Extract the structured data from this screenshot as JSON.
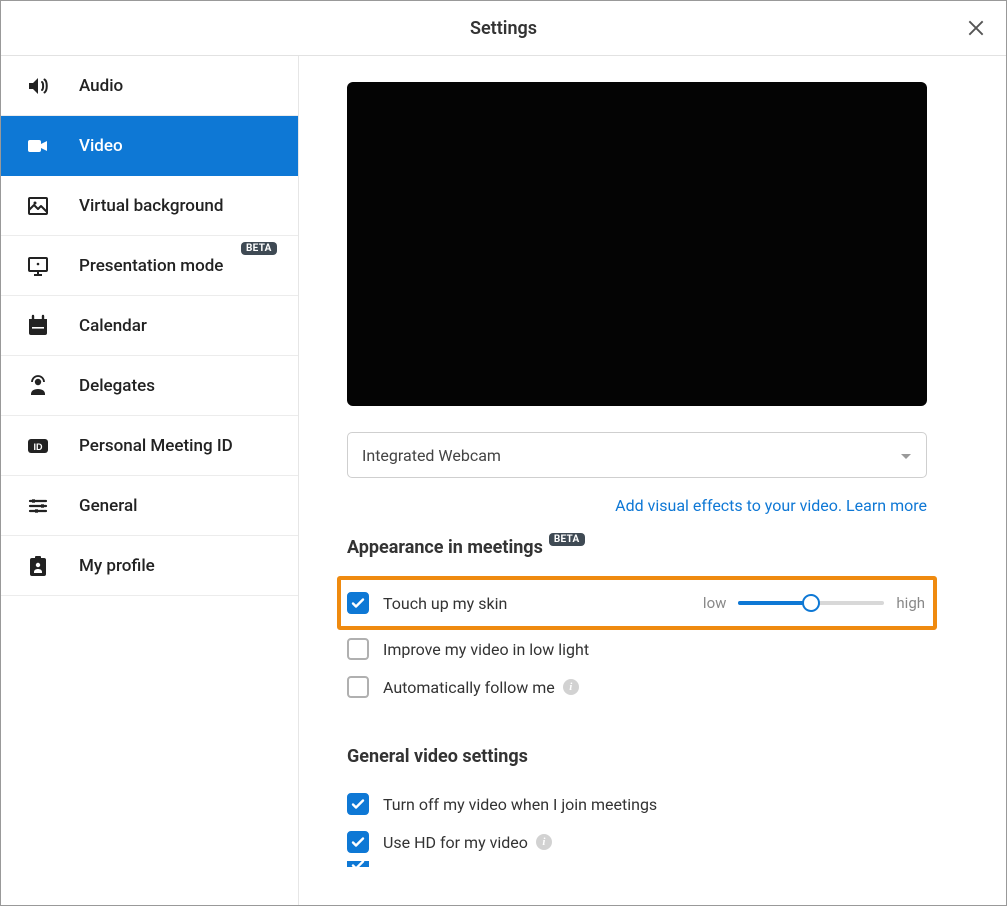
{
  "header": {
    "title": "Settings"
  },
  "sidebar": {
    "items": [
      {
        "label": "Audio"
      },
      {
        "label": "Video"
      },
      {
        "label": "Virtual background"
      },
      {
        "label": "Presentation mode",
        "badge": "BETA"
      },
      {
        "label": "Calendar"
      },
      {
        "label": "Delegates"
      },
      {
        "label": "Personal Meeting ID"
      },
      {
        "label": "General"
      },
      {
        "label": "My profile"
      }
    ]
  },
  "video": {
    "camera_selected": "Integrated Webcam",
    "effects_link": "Add visual effects to your video. Learn more",
    "appearance_heading": "Appearance in meetings",
    "appearance_badge": "BETA",
    "touch_up_label": "Touch up my skin",
    "slider_low": "low",
    "slider_high": "high",
    "low_light_label": "Improve my video in low light",
    "auto_follow_label": "Automatically follow me",
    "general_heading": "General video settings",
    "turn_off_label": "Turn off my video when I join meetings",
    "use_hd_label": "Use HD for my video"
  }
}
